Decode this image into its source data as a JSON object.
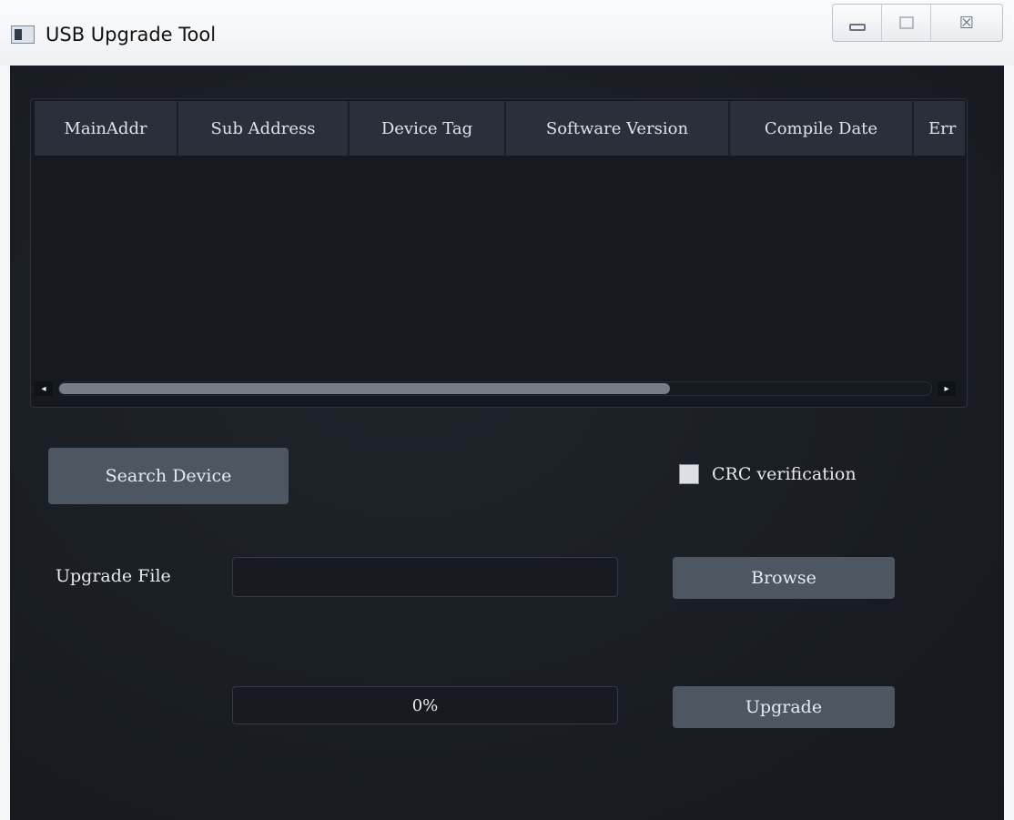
{
  "window": {
    "title": "USB Upgrade Tool",
    "controls": {
      "minimize_icon": "minimize-icon",
      "maximize_icon": "maximize-icon",
      "close_glyph": "☒"
    }
  },
  "device_table": {
    "columns": [
      "MainAddr",
      "Sub Address",
      "Device Tag",
      "Software Version",
      "Compile Date",
      "Err"
    ],
    "rows": [],
    "scrollbar": {
      "left_arrow": "◂",
      "right_arrow": "▸",
      "thumb_fraction": 0.7
    }
  },
  "search_button": {
    "label": "Search Device"
  },
  "crc": {
    "label": "CRC verification",
    "checked": false
  },
  "upgrade_file": {
    "label": "Upgrade File",
    "value": "",
    "placeholder": ""
  },
  "browse_button": {
    "label": "Browse"
  },
  "progress": {
    "text": "0%",
    "percent": 0
  },
  "upgrade_button": {
    "label": "Upgrade"
  },
  "colors": {
    "background": "#181c22",
    "button": "#4d5762",
    "header": "#293039",
    "text": "#e6e9ed"
  }
}
